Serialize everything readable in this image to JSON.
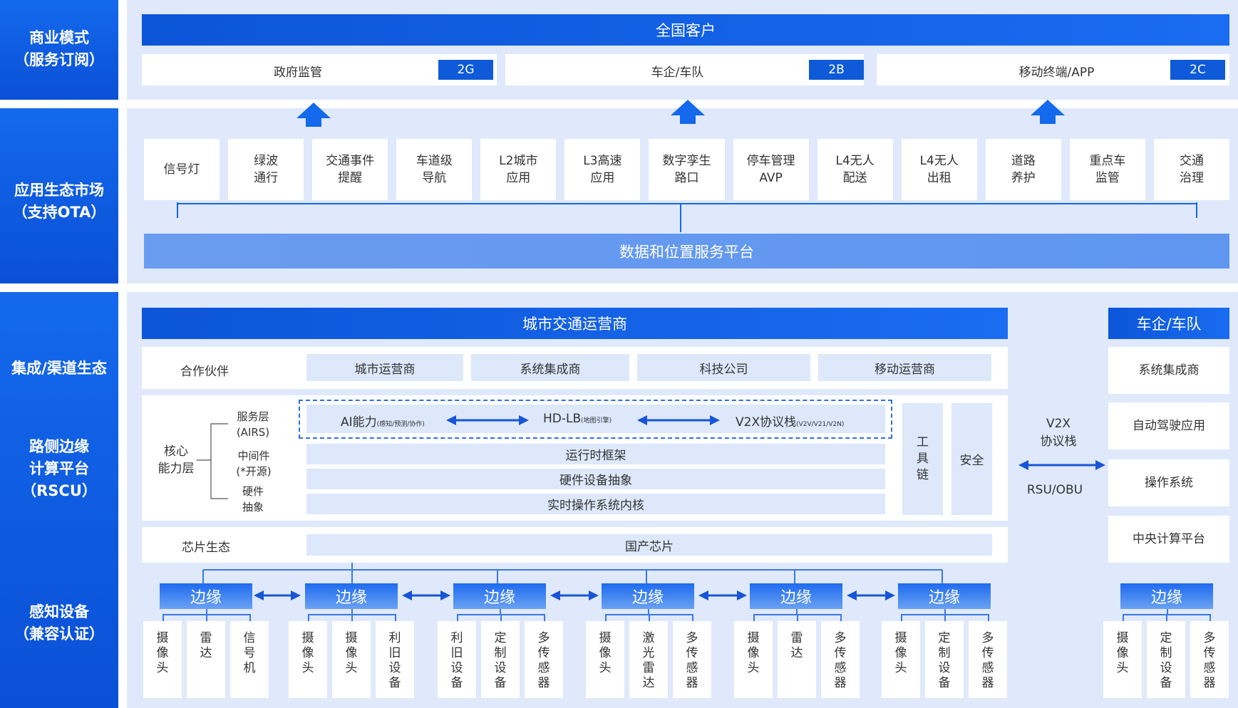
{
  "sidebar": {
    "business": [
      "商业模式",
      "（服务订阅）"
    ],
    "app_market": [
      "应用生态市场",
      "（支持OTA）"
    ],
    "integration": [
      "集成/渠道生态"
    ],
    "edge_platform": [
      "路侧边缘",
      "计算平台",
      "（RSCU）"
    ],
    "sensing": [
      "感知设备",
      "（兼容认证）"
    ]
  },
  "customers": {
    "title": "全国客户",
    "groups": [
      {
        "label": "政府监管",
        "tag": "2G"
      },
      {
        "label": "车企/车队",
        "tag": "2B"
      },
      {
        "label": "移动终端/APP",
        "tag": "2C"
      }
    ]
  },
  "apps": {
    "items": [
      [
        "信号灯"
      ],
      [
        "绿波",
        "通行"
      ],
      [
        "交通事件",
        "提醒"
      ],
      [
        "车道级",
        "导航"
      ],
      [
        "L2城市",
        "应用"
      ],
      [
        "L3高速",
        "应用"
      ],
      [
        "数字孪生",
        "路口"
      ],
      [
        "停车管理",
        "AVP"
      ],
      [
        "L4无人",
        "配送"
      ],
      [
        "L4无人",
        "出租"
      ],
      [
        "道路",
        "养护"
      ],
      [
        "重点车",
        "监管"
      ],
      [
        "交通",
        "治理"
      ]
    ],
    "platform": "数据和位置服务平台"
  },
  "operator": {
    "title": "城市交通运营商",
    "partner_label": "合作伙伴",
    "partners": [
      "城市运营商",
      "系统集成商",
      "科技公司",
      "移动运营商"
    ],
    "core_label": [
      "核心",
      "能力层"
    ],
    "layers": [
      [
        "服务层",
        "(AIRS)"
      ],
      [
        "中间件",
        "(*开源)"
      ],
      [
        "硬件",
        "抽象"
      ]
    ],
    "services": [
      {
        "name": "AI能力",
        "note": "(感知/预测/协作)"
      },
      {
        "name": "HD-LB",
        "note": "(地图引擎)"
      },
      {
        "name": "V2X协议栈",
        "note": "(V2V/V21/V2N)"
      }
    ],
    "middleware": [
      "运行时框架",
      "硬件设备抽象",
      "实时操作系统内核"
    ],
    "toolchain": [
      "工",
      "具",
      "链"
    ],
    "security": "安全",
    "chip_label": "芯片生态",
    "chip": "国产芯片"
  },
  "v2x": {
    "line1": "V2X",
    "line2": "协议栈",
    "rsu": "RSU/OBU"
  },
  "vehicle": {
    "title": "车企/车队",
    "items": [
      "系统集成商",
      "自动驾驶应用",
      "操作系统",
      "中央计算平台"
    ]
  },
  "edge_label": "边缘",
  "sensor_groups": [
    [
      [
        "摄",
        "像",
        "头"
      ],
      [
        "雷",
        "达"
      ],
      [
        "信",
        "号",
        "机"
      ]
    ],
    [
      [
        "摄",
        "像",
        "头"
      ],
      [
        "摄",
        "像",
        "头"
      ],
      [
        "利",
        "旧",
        "设",
        "备"
      ]
    ],
    [
      [
        "利",
        "旧",
        "设",
        "备"
      ],
      [
        "定",
        "制",
        "设",
        "备"
      ],
      [
        "多",
        "传",
        "感",
        "器"
      ]
    ],
    [
      [
        "摄",
        "像",
        "头"
      ],
      [
        "激",
        "光",
        "雷",
        "达"
      ],
      [
        "多",
        "传",
        "感",
        "器"
      ]
    ],
    [
      [
        "摄",
        "像",
        "头"
      ],
      [
        "雷",
        "达"
      ],
      [
        "多",
        "传",
        "感",
        "器"
      ]
    ],
    [
      [
        "摄",
        "像",
        "头"
      ],
      [
        "定",
        "制",
        "设",
        "备"
      ],
      [
        "多",
        "传",
        "感",
        "器"
      ]
    ],
    [
      [
        "摄",
        "像",
        "头"
      ],
      [
        "定",
        "制",
        "设",
        "备"
      ],
      [
        "多",
        "传",
        "感",
        "器"
      ]
    ]
  ],
  "colors": {
    "primary": "#0c55d8",
    "panel": "#dfe9fb",
    "light_box": "#dde8fb"
  }
}
